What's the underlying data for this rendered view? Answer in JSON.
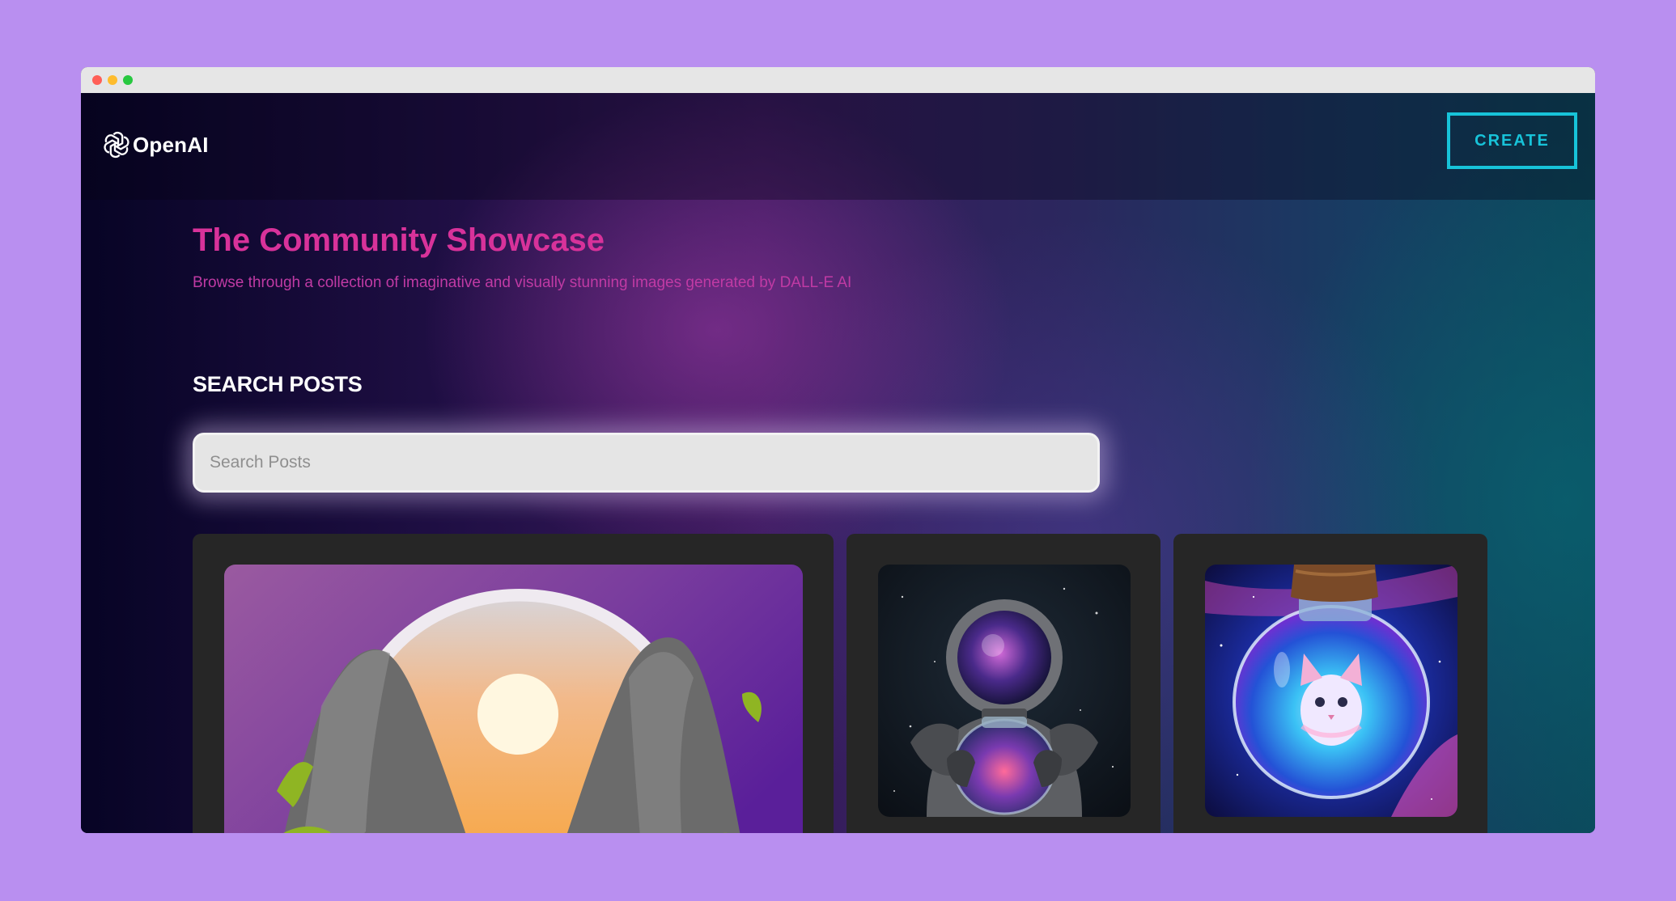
{
  "navbar": {
    "logo_text": "OpenAI",
    "logo_icon": "openai-logo-icon",
    "create_label": "CREATE"
  },
  "hero": {
    "title": "The Community Showcase",
    "subtitle": "Browse through a collection of imaginative and visually stunning images generated by DALL-E AI"
  },
  "search": {
    "heading": "SEARCH POSTS",
    "placeholder": "Search Posts",
    "value": ""
  },
  "posts": [
    {
      "image": "mountains-sunset-image"
    },
    {
      "image": "astronaut-galaxy-jar-image"
    },
    {
      "image": "cat-in-galaxy-jar-image"
    }
  ],
  "colors": {
    "page_background": "#b98ff0",
    "accent_cyan": "#17c3d9",
    "title_pink": "#d8329a",
    "card_background": "#262626"
  }
}
